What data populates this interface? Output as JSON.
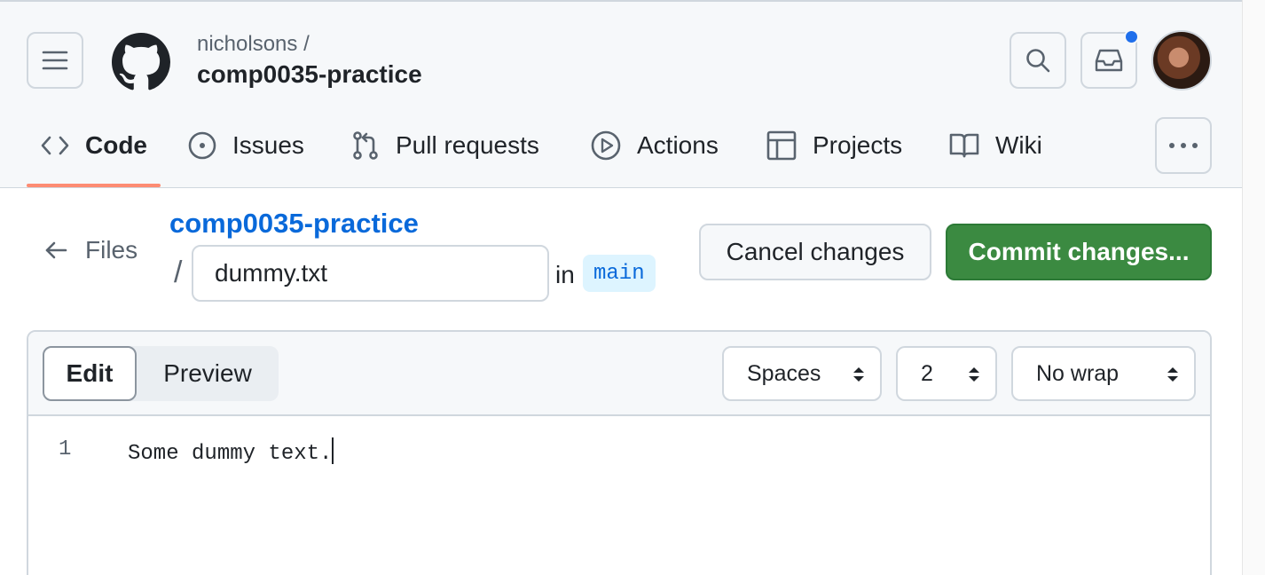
{
  "header": {
    "owner": "nicholsons /",
    "repo": "comp0035-practice"
  },
  "tabs": [
    {
      "label": "Code",
      "icon": "code-icon",
      "active": true
    },
    {
      "label": "Issues",
      "icon": "issue-icon"
    },
    {
      "label": "Pull requests",
      "icon": "pull-request-icon"
    },
    {
      "label": "Actions",
      "icon": "play-icon"
    },
    {
      "label": "Projects",
      "icon": "table-icon"
    },
    {
      "label": "Wiki",
      "icon": "book-icon"
    }
  ],
  "breadcrumb": {
    "back_label": "Files",
    "repo": "comp0035-practice",
    "separator": "/",
    "in_word": "in",
    "branch": "main"
  },
  "filename": {
    "value": "dummy.txt"
  },
  "actions": {
    "cancel_label": "Cancel changes",
    "commit_label": "Commit changes..."
  },
  "editor": {
    "edit_label": "Edit",
    "preview_label": "Preview",
    "indent_mode": "Spaces",
    "indent_size": "2",
    "wrap_mode": "No wrap",
    "lines": [
      {
        "number": "1",
        "text": "Some dummy text."
      }
    ]
  },
  "colors": {
    "accent": "#0969da",
    "commit_green": "#3b8a41",
    "tab_underline": "#fd8c73",
    "notification": "#1f6feb"
  }
}
